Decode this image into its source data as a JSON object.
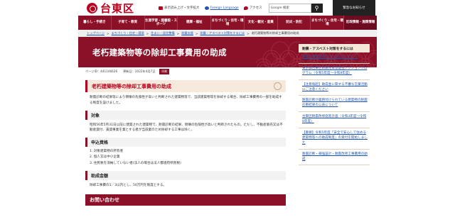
{
  "header": {
    "logo_text": "台東区",
    "utility": [
      {
        "label": "表示読み上げ・文字拡大",
        "icon": "speaker-icon"
      },
      {
        "label": "Foreign Language",
        "icon": "globe-icon"
      },
      {
        "label": "アクセス",
        "icon": "pin-icon"
      }
    ],
    "search_placeholder": "Google 検索",
    "emergency_label": "緊急なお知らせ"
  },
  "gnav": [
    "暮らし・手続き",
    "子育て・教育",
    "生涯学習・図書館・スポーツ",
    "健康・福祉",
    "まちづくり・住宅・環境",
    "文化・観光・産業",
    "防災・防犯",
    "まちづくり・住宅・環境",
    "区政情報・施策情報"
  ],
  "breadcrumb": [
    {
      "label": "トップページ",
      "link": true
    },
    {
      "label": ">",
      "link": false
    },
    {
      "label": "まちづくり・住宅・環境",
      "link": true
    },
    {
      "label": ">",
      "link": false
    },
    {
      "label": "住まい・居住整備",
      "link": true
    },
    {
      "label": ">",
      "link": false
    },
    {
      "label": "耐震支援",
      "link": true
    },
    {
      "label": ">",
      "link": false
    },
    {
      "label": "耐震・アスベスト対策をするには",
      "link": true
    },
    {
      "label": ">",
      "link": false
    },
    {
      "label": "老朽建築物等の除却工事費用の助成",
      "link": false
    }
  ],
  "hero": {
    "title": "老朽建築物等の除却工事費用の助成"
  },
  "meta": {
    "page_id": "ページID：441146626",
    "updated": "更新日：2022年4月7日",
    "print_label": "印刷"
  },
  "content": {
    "h2": "老朽建築物等の除却工事費用の助成",
    "intro": "耐震診断の結果等により倒壊の危険性が高いと判断された建築物等で、当該建築物等を除却する場合、除却工事費用の一部を助成する制度を設けました。",
    "sections": [
      {
        "heading": "対象",
        "body": "昭和56年5月31日以前に建築された建築物で、耐震診断の結果、倒壊の危険性が高いと判断されたもの。ただし、不動産販売又は不動産貸付、賃貸事業を業とする者が当該業のため除却する工事は除く。"
      },
      {
        "heading": "申込資格",
        "items": [
          "1. 対象建築物の所有者",
          "2. 個人又は中小企業",
          "3. 住民税を滞納していない者(法人の場合は法人都道府県民税)"
        ]
      },
      {
        "heading": "助成金額",
        "body": "除却工事費の1／3以内とし、50万円を限度とする。"
      }
    ],
    "next_band": "お問い合わせ"
  },
  "sidebar": {
    "heading": "耐震・アスベスト対策をするには",
    "items": [
      "耐震診断事業者リストの公表について",
      "東京都台東区耐震化緊急促進アクションプログラム（令和5年度～令和8年度）",
      "【注意喚起】助成金に関する不審な営業活動にご注意ください",
      "耐震診断が義務付けられている建築物の耐震診断結果の公表について",
      "台東区耐震改修促進計画（令和3年度～令和8年度）",
      "【重要】令和5年度「安全で安心して住める建築物等への助成制度」の受付を開始しました",
      "耐震診断・補強設計・耐震改修工事費用の助成"
    ]
  }
}
